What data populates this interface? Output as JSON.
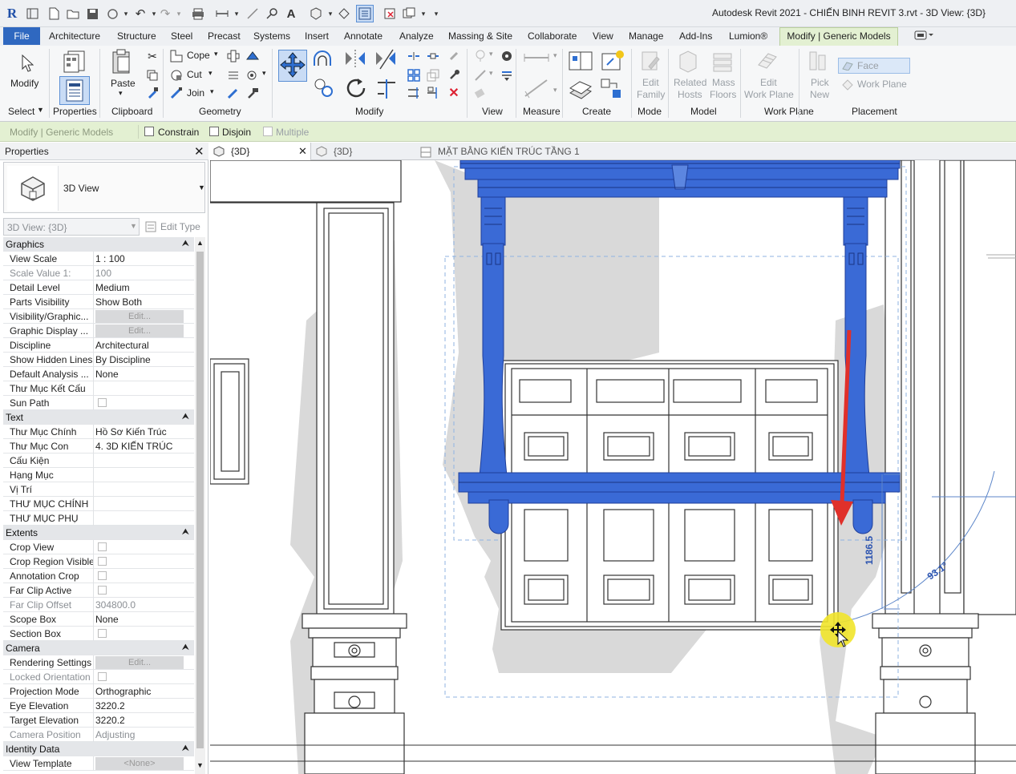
{
  "app": {
    "title": "Autodesk Revit 2021 - CHIẾN BINH REVIT 3.rvt - 3D View: {3D}"
  },
  "menu": {
    "file": "File",
    "tabs": [
      "Architecture",
      "Structure",
      "Steel",
      "Precast",
      "Systems",
      "Insert",
      "Annotate",
      "Analyze",
      "Massing & Site",
      "Collaborate",
      "View",
      "Manage",
      "Add-Ins",
      "Lumion®"
    ],
    "context_tab": "Modify | Generic Models"
  },
  "ribbon": {
    "select": {
      "modify": "Modify",
      "panel": "Select"
    },
    "properties": {
      "panel": "Properties"
    },
    "clipboard": {
      "paste": "Paste",
      "panel": "Clipboard"
    },
    "geometry": {
      "cope": "Cope",
      "cut": "Cut",
      "join": "Join",
      "panel": "Geometry"
    },
    "modify": {
      "panel": "Modify"
    },
    "view": {
      "panel": "View"
    },
    "measure": {
      "panel": "Measure"
    },
    "create": {
      "panel": "Create"
    },
    "mode": {
      "edit_family_1": "Edit",
      "edit_family_2": "Family",
      "panel": "Mode"
    },
    "model": {
      "related_1": "Related",
      "related_2": "Hosts",
      "mass_1": "Mass",
      "mass_2": "Floors",
      "panel": "Model"
    },
    "workplane": {
      "edit_1": "Edit",
      "edit_2": "Work Plane",
      "panel": "Work Plane"
    },
    "placement": {
      "pick_1": "Pick",
      "pick_2": "New",
      "face": "Face",
      "workplane": "Work Plane",
      "panel": "Placement"
    }
  },
  "options_bar": {
    "label": "Modify | Generic Models",
    "constrain": "Constrain",
    "disjoin": "Disjoin",
    "multiple": "Multiple"
  },
  "properties": {
    "title": "Properties",
    "type_name": "3D View",
    "instance": "3D View: {3D}",
    "edit_type": "Edit Type",
    "rows": [
      {
        "section": "Graphics"
      },
      {
        "k": "View Scale",
        "v": "1 : 100"
      },
      {
        "k": "Scale Value    1:",
        "v": "100",
        "gray": true
      },
      {
        "k": "Detail Level",
        "v": "Medium"
      },
      {
        "k": "Parts Visibility",
        "v": "Show Both"
      },
      {
        "k": "Visibility/Graphic...",
        "btn": "Edit..."
      },
      {
        "k": "Graphic Display ...",
        "btn": "Edit..."
      },
      {
        "k": "Discipline",
        "v": "Architectural"
      },
      {
        "k": "Show Hidden Lines",
        "v": "By Discipline"
      },
      {
        "k": "Default Analysis ...",
        "v": "None"
      },
      {
        "k": "Thư Mục Kết Cấu",
        "v": ""
      },
      {
        "k": "Sun Path",
        "cb": true
      },
      {
        "section": "Text"
      },
      {
        "k": "Thư Mục Chính",
        "v": "Hồ Sơ Kiến Trúc"
      },
      {
        "k": "Thư Mục Con",
        "v": "4. 3D KIẾN TRÚC"
      },
      {
        "k": "Cấu Kiện",
        "v": ""
      },
      {
        "k": "Hạng Mục",
        "v": ""
      },
      {
        "k": "Vị Trí",
        "v": ""
      },
      {
        "k": "THƯ MỤC CHÍNH",
        "v": ""
      },
      {
        "k": "THƯ MỤC PHỤ",
        "v": ""
      },
      {
        "section": "Extents"
      },
      {
        "k": "Crop View",
        "cb": true
      },
      {
        "k": "Crop Region Visible",
        "cb": true
      },
      {
        "k": "Annotation Crop",
        "cb": true
      },
      {
        "k": "Far Clip Active",
        "cb": true
      },
      {
        "k": "Far Clip Offset",
        "v": "304800.0",
        "gray": true
      },
      {
        "k": "Scope Box",
        "v": "None"
      },
      {
        "k": "Section Box",
        "cb": true
      },
      {
        "section": "Camera"
      },
      {
        "k": "Rendering Settings",
        "btn": "Edit..."
      },
      {
        "k": "Locked Orientation",
        "cb": true,
        "gray": true
      },
      {
        "k": "Projection Mode",
        "v": "Orthographic"
      },
      {
        "k": "Eye Elevation",
        "v": "3220.2"
      },
      {
        "k": "Target Elevation",
        "v": "3220.2"
      },
      {
        "k": "Camera Position",
        "v": "Adjusting",
        "gray": true
      },
      {
        "section": "Identity Data"
      },
      {
        "k": "View Template",
        "btn": "<None>"
      }
    ]
  },
  "view_tabs": [
    {
      "label": "{3D}",
      "active": true
    },
    {
      "label": "{3D}",
      "active": false
    },
    {
      "label": "MẶT BẰNG KIẾN TRÚC TẦNG 1",
      "active": false
    }
  ],
  "canvas": {
    "dim_1": "1186.5",
    "dim_2": "93.1°"
  },
  "colors": {
    "accent": "#2f68c0",
    "selection": "#3264d4",
    "context": "#e3f0d2",
    "arrow": "#e0302a",
    "cursor_halo": "#f1e42a"
  }
}
